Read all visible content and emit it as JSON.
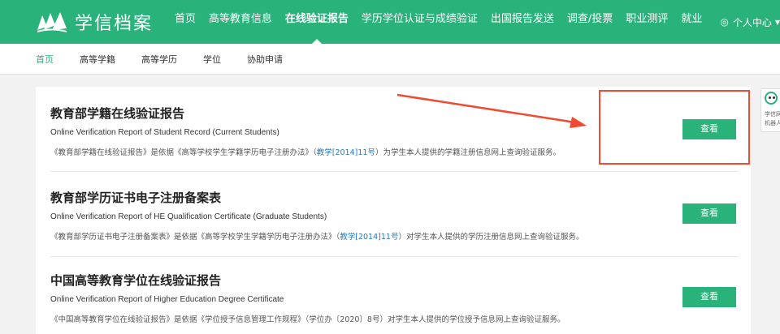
{
  "header": {
    "logo_text": "学信档案",
    "nav": [
      {
        "label": "首页"
      },
      {
        "label": "高等教育信息"
      },
      {
        "label": "在线验证报告"
      },
      {
        "label": "学历学位认证与成绩验证"
      },
      {
        "label": "出国报告发送"
      },
      {
        "label": "调查/投票"
      },
      {
        "label": "职业测评"
      },
      {
        "label": "就业"
      }
    ],
    "active_nav_index": 2,
    "user_center": "个人中心"
  },
  "subnav": [
    {
      "label": "首页"
    },
    {
      "label": "高等学籍"
    },
    {
      "label": "高等学历"
    },
    {
      "label": "学位"
    },
    {
      "label": "协助申请"
    }
  ],
  "cards": [
    {
      "title": "教育部学籍在线验证报告",
      "subtitle": "Online Verification Report of Student Record (Current Students)",
      "desc_before": "《教育部学籍在线验证报告》是依据《高等学校学生学籍学历电子注册办法》（",
      "desc_doc": "教学[2014]11号",
      "desc_after": "）为学生本人提供的学籍注册信息网上查询验证服务。",
      "button": "查看"
    },
    {
      "title": "教育部学历证书电子注册备案表",
      "subtitle": "Online Verification Report of HE Qualification Certificate (Graduate Students)",
      "desc_before": "《教育部学历证书电子注册备案表》是依据《高等学校学生学籍学历电子注册办法》（",
      "desc_doc": "教学[2014]11号",
      "desc_after": "）对学生本人提供的学历注册信息网上查询验证服务。",
      "button": "查看"
    },
    {
      "title": "中国高等教育学位在线验证报告",
      "subtitle": "Online Verification Report of Higher Education Degree Certificate",
      "desc_before": "《中国高等教育学位在线验证报告》是依据《学位授予信息管理工作规程》（学位办〔2020〕8号）对学生本人提供的学位授予信息网上查询验证服务。",
      "desc_doc": "",
      "desc_after": "",
      "button": "查看"
    }
  ],
  "side_widget": {
    "line1": "学信网",
    "line2": "机器人"
  },
  "colors": {
    "brand": "#2ab27b",
    "link": "#2a7ab8",
    "annotation": "#f04a33"
  }
}
